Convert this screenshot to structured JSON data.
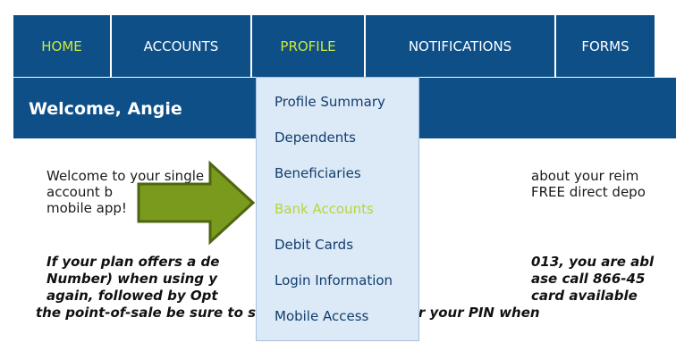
{
  "nav": {
    "tabs": [
      {
        "label": "HOME",
        "active": true
      },
      {
        "label": "ACCOUNTS",
        "active": false
      },
      {
        "label": "PROFILE",
        "active": true
      },
      {
        "label": "NOTIFICATIONS",
        "active": false
      },
      {
        "label": "FORMS",
        "active": false
      }
    ]
  },
  "welcome": {
    "title": "Welcome, Angie"
  },
  "body": {
    "line1_left": "Welcome to your single",
    "line1_right": "about your reim",
    "line2_left": "account b",
    "line2_right": "FREE direct depo",
    "line3_left": "mobile app!",
    "line4_left": "If your plan offers a de",
    "line4_right": "013, you are abl",
    "line5_left": "Number) when using y",
    "line5_right": "ase call 866-45",
    "line6_left": "again, followed by Opt",
    "line6_right": "card available",
    "line7": "the point-of-sale be sure to select 'Debit' and enter your PIN when"
  },
  "dropdown": {
    "items": [
      {
        "label": "Profile Summary"
      },
      {
        "label": "Dependents"
      },
      {
        "label": "Beneficiaries"
      },
      {
        "label": "Bank Accounts",
        "highlighted": true
      },
      {
        "label": "Debit Cards"
      },
      {
        "label": "Login Information"
      },
      {
        "label": "Mobile Access"
      }
    ]
  },
  "colors": {
    "nav_bg": "#0e4f88",
    "accent": "#cdea3a",
    "dropdown_bg": "#dce9f7",
    "arrow": "#7a9a1e"
  },
  "icons": {
    "arrow": "green-right-arrow-icon"
  }
}
